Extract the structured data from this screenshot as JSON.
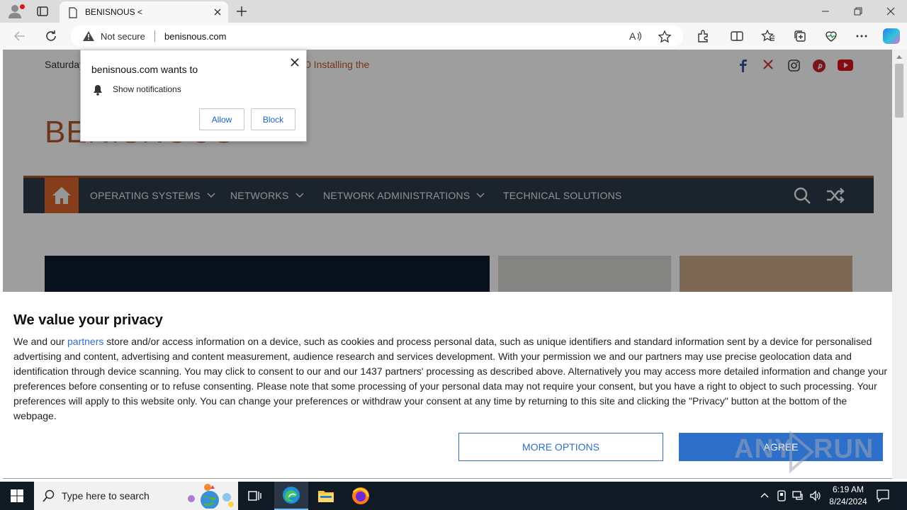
{
  "browser": {
    "tab_title": "BENISNOUS <",
    "security_label": "Not secure",
    "url": "benisnous.com"
  },
  "website": {
    "date_text": "Saturday",
    "ticker_text": "0 Installing the",
    "logo_text": "BENISNOUS",
    "nav": [
      {
        "label": "OPERATING SYSTEMS"
      },
      {
        "label": "NETWORKS"
      },
      {
        "label": "NETWORK ADMINISTRATIONS"
      },
      {
        "label": "TECHNICAL SOLUTIONS"
      }
    ],
    "social": [
      "facebook-icon",
      "x-icon",
      "instagram-icon",
      "pinterest-icon",
      "youtube-icon"
    ],
    "accent_color": "#d9632b"
  },
  "notification_prompt": {
    "title": "benisnous.com wants to",
    "permission": "Show notifications",
    "allow_label": "Allow",
    "block_label": "Block"
  },
  "privacy": {
    "heading": "We value your privacy",
    "body_before_link": "We and our ",
    "link_text": "partners",
    "body_after_link": " store and/or access information on a device, such as cookies and process personal data, such as unique identifiers and standard information sent by a device for personalised advertising and content, advertising and content measurement, audience research and services development. With your permission we and our partners may use precise geolocation data and identification through device scanning. You may click to consent to our and our 1437 partners' processing as described above. Alternatively you may access more detailed information and change your preferences before consenting or to refuse consenting. Please note that some processing of your personal data may not require your consent, but you have a right to object to such processing. Your preferences will apply to this website only. You can change your preferences or withdraw your consent at any time by returning to this site and clicking the \"Privacy\" button at the bottom of the webpage.",
    "more_options_label": "MORE OPTIONS",
    "agree_label": "AGREE",
    "button_color": "#2e6fc9"
  },
  "watermark": {
    "left": "ANY",
    "right": "RUN"
  },
  "taskbar": {
    "search_placeholder": "Type here to search",
    "time": "6:19 AM",
    "date": "8/24/2024"
  }
}
